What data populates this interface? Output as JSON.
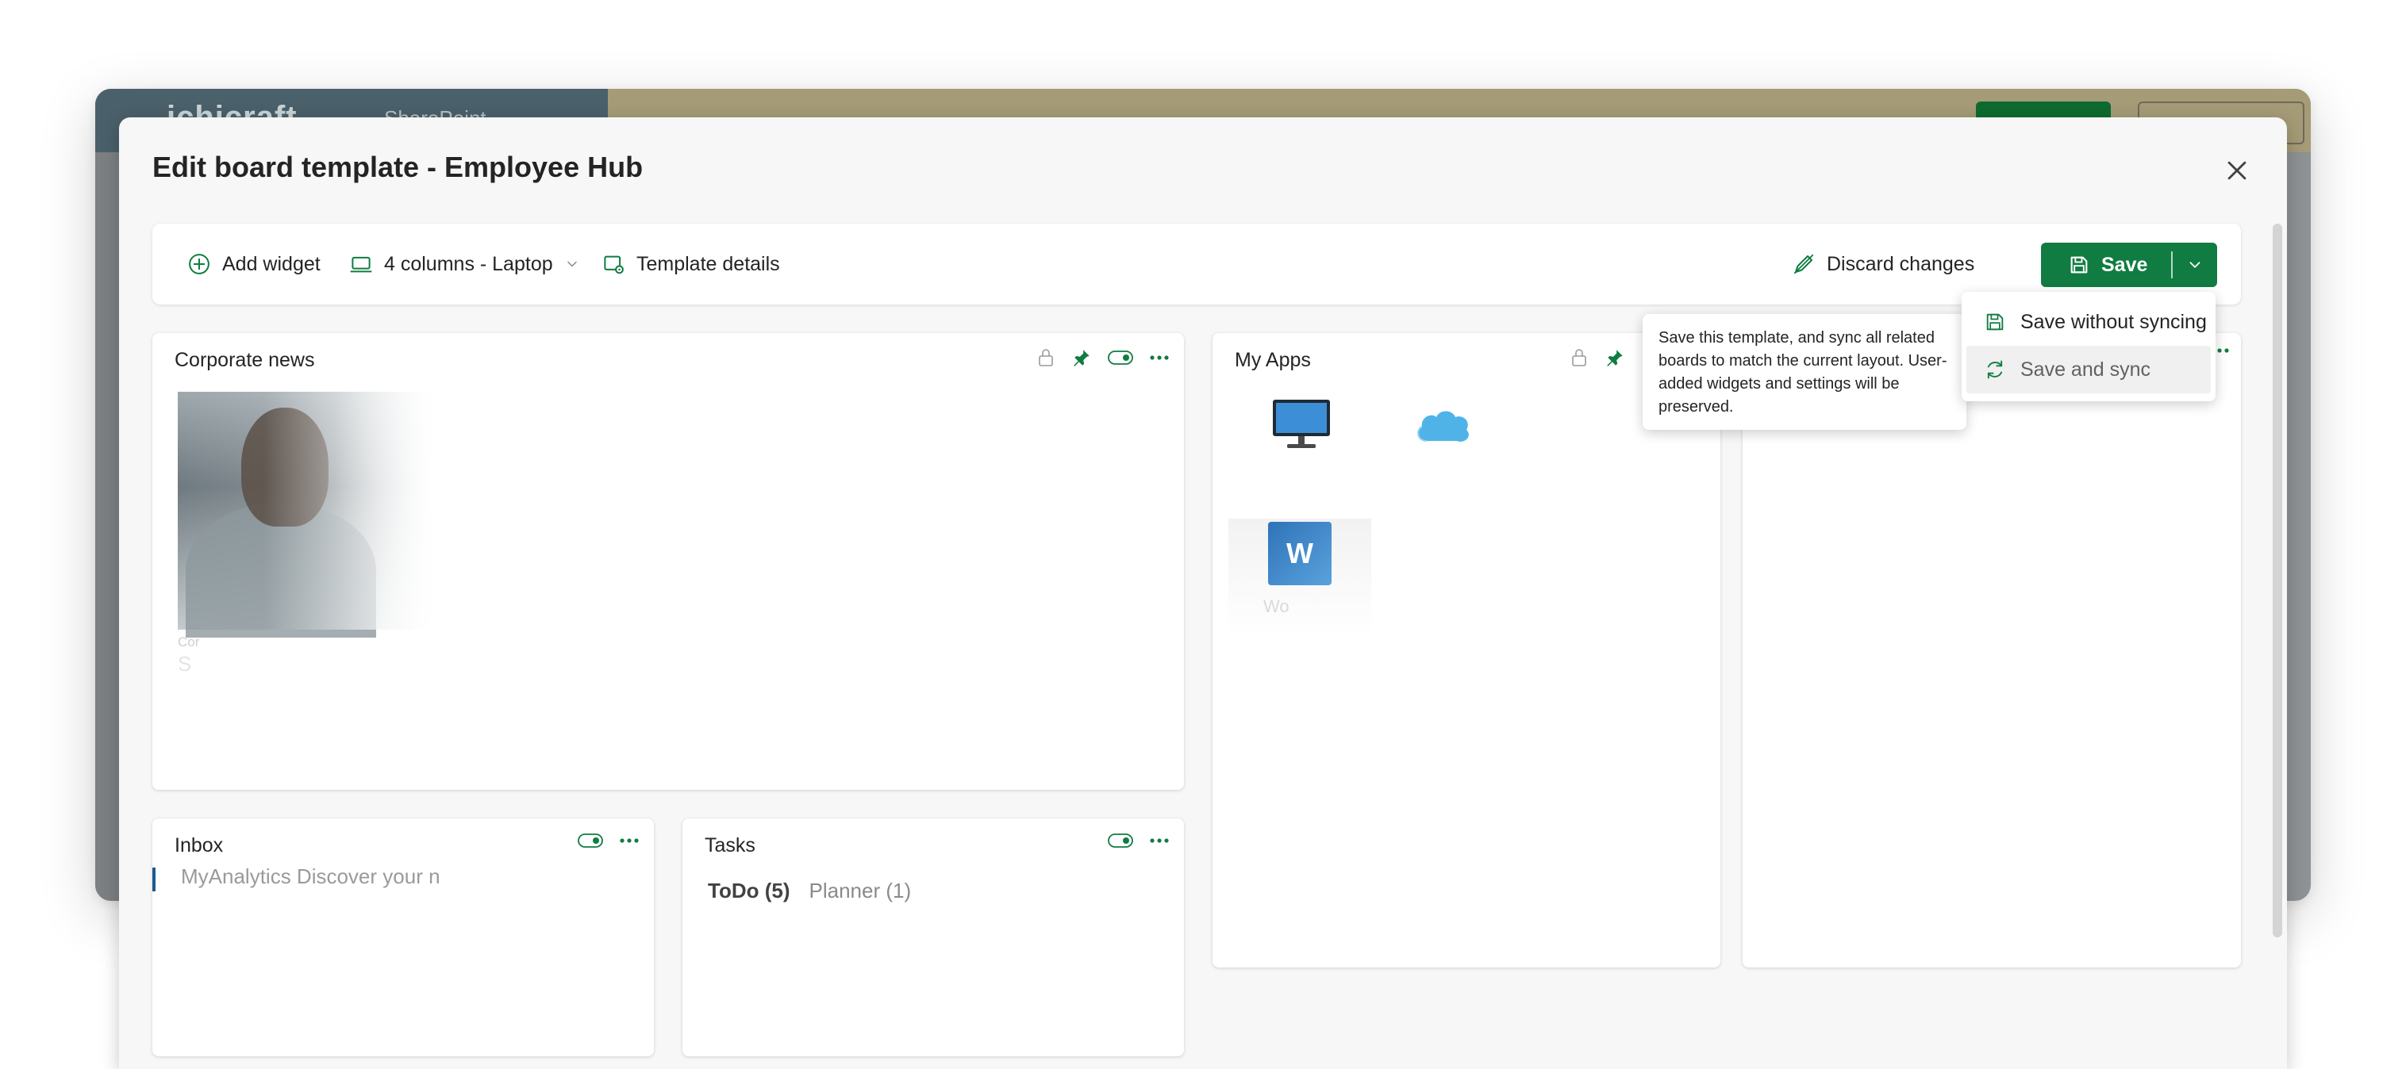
{
  "background": {
    "brand": "ichicraft",
    "brand_sub": "SharePoint"
  },
  "modal": {
    "title": "Edit board template - Employee Hub",
    "close_icon": "close-icon"
  },
  "toolbar": {
    "add_widget_label": "Add widget",
    "layout_label": "4 columns - Laptop",
    "template_details_label": "Template details",
    "discard_label": "Discard changes",
    "save_label": "Save"
  },
  "save_menu": {
    "items": [
      {
        "label": "Save without syncing",
        "icon": "save-icon"
      },
      {
        "label": "Save and sync",
        "icon": "sync-icon"
      }
    ]
  },
  "tooltip": {
    "text": "Save this template, and sync all related boards to match the current layout. User-added widgets and settings will be preserved."
  },
  "widgets": {
    "corporate_news": {
      "title": "Corporate news",
      "caption_1": "Cor",
      "caption_2": "S"
    },
    "my_apps": {
      "title": "My Apps",
      "app_label": "Wo"
    },
    "inbox": {
      "title": "Inbox",
      "preview": "MyAnalytics Discover your n"
    },
    "tasks": {
      "title": "Tasks",
      "tab_todo": "ToDo (5)",
      "tab_planner": "Planner (1)"
    }
  },
  "colors": {
    "accent": "#107c41",
    "pin": "#107c41",
    "text": "#242424"
  }
}
